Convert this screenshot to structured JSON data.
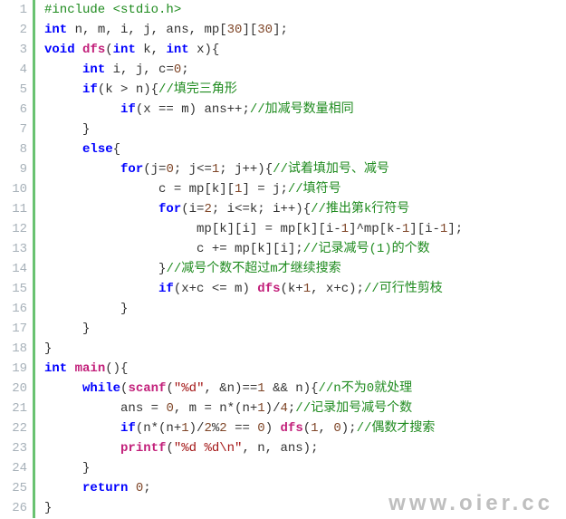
{
  "watermark": "www.oier.cc",
  "lines": [
    {
      "n": "1",
      "tokens": [
        {
          "t": "#include ",
          "c": "tok-inc"
        },
        {
          "t": "<stdio.h>",
          "c": "tok-inc"
        }
      ]
    },
    {
      "n": "2",
      "tokens": [
        {
          "t": "int",
          "c": "tok-kw"
        },
        {
          "t": " n, m, i, j, ans, mp[",
          "c": "tok-id"
        },
        {
          "t": "30",
          "c": "tok-num"
        },
        {
          "t": "][",
          "c": "tok-id"
        },
        {
          "t": "30",
          "c": "tok-num"
        },
        {
          "t": "];",
          "c": "tok-id"
        }
      ]
    },
    {
      "n": "3",
      "tokens": [
        {
          "t": "void",
          "c": "tok-kw"
        },
        {
          "t": " ",
          "c": "tok-id"
        },
        {
          "t": "dfs",
          "c": "tok-fn"
        },
        {
          "t": "(",
          "c": "tok-id"
        },
        {
          "t": "int",
          "c": "tok-kw"
        },
        {
          "t": " k, ",
          "c": "tok-id"
        },
        {
          "t": "int",
          "c": "tok-kw"
        },
        {
          "t": " x){",
          "c": "tok-id"
        }
      ]
    },
    {
      "n": "4",
      "indent": 1,
      "tokens": [
        {
          "t": "int",
          "c": "tok-kw"
        },
        {
          "t": " i, j, c=",
          "c": "tok-id"
        },
        {
          "t": "0",
          "c": "tok-num"
        },
        {
          "t": ";",
          "c": "tok-id"
        }
      ]
    },
    {
      "n": "5",
      "indent": 1,
      "tokens": [
        {
          "t": "if",
          "c": "tok-kw"
        },
        {
          "t": "(k > n){",
          "c": "tok-id"
        },
        {
          "t": "//填完三角形",
          "c": "tok-cmt"
        }
      ]
    },
    {
      "n": "6",
      "indent": 2,
      "tokens": [
        {
          "t": "if",
          "c": "tok-kw"
        },
        {
          "t": "(x == m) ans++;",
          "c": "tok-id"
        },
        {
          "t": "//加减号数量相同",
          "c": "tok-cmt"
        }
      ]
    },
    {
      "n": "7",
      "indent": 1,
      "tokens": [
        {
          "t": "}",
          "c": "tok-id"
        }
      ]
    },
    {
      "n": "8",
      "indent": 1,
      "tokens": [
        {
          "t": "else",
          "c": "tok-kw"
        },
        {
          "t": "{",
          "c": "tok-id"
        }
      ]
    },
    {
      "n": "9",
      "indent": 2,
      "tokens": [
        {
          "t": "for",
          "c": "tok-kw"
        },
        {
          "t": "(j=",
          "c": "tok-id"
        },
        {
          "t": "0",
          "c": "tok-num"
        },
        {
          "t": "; j<=",
          "c": "tok-id"
        },
        {
          "t": "1",
          "c": "tok-num"
        },
        {
          "t": "; j++){",
          "c": "tok-id"
        },
        {
          "t": "//试着填加号、减号",
          "c": "tok-cmt"
        }
      ]
    },
    {
      "n": "10",
      "indent": 3,
      "tokens": [
        {
          "t": "c = mp[k][",
          "c": "tok-id"
        },
        {
          "t": "1",
          "c": "tok-num"
        },
        {
          "t": "] = j;",
          "c": "tok-id"
        },
        {
          "t": "//填符号",
          "c": "tok-cmt"
        }
      ]
    },
    {
      "n": "11",
      "indent": 3,
      "tokens": [
        {
          "t": "for",
          "c": "tok-kw"
        },
        {
          "t": "(i=",
          "c": "tok-id"
        },
        {
          "t": "2",
          "c": "tok-num"
        },
        {
          "t": "; i<=k; i++){",
          "c": "tok-id"
        },
        {
          "t": "//推出第k行符号",
          "c": "tok-cmt"
        }
      ]
    },
    {
      "n": "12",
      "indent": 4,
      "tokens": [
        {
          "t": "mp[k][i] = mp[k][i-",
          "c": "tok-id"
        },
        {
          "t": "1",
          "c": "tok-num"
        },
        {
          "t": "]^mp[k-",
          "c": "tok-id"
        },
        {
          "t": "1",
          "c": "tok-num"
        },
        {
          "t": "][i-",
          "c": "tok-id"
        },
        {
          "t": "1",
          "c": "tok-num"
        },
        {
          "t": "];",
          "c": "tok-id"
        }
      ]
    },
    {
      "n": "13",
      "indent": 4,
      "tokens": [
        {
          "t": "c += mp[k][i];",
          "c": "tok-id"
        },
        {
          "t": "//记录减号(1)的个数",
          "c": "tok-cmt"
        }
      ]
    },
    {
      "n": "14",
      "indent": 3,
      "tokens": [
        {
          "t": "}",
          "c": "tok-id"
        },
        {
          "t": "//减号个数不超过m才继续搜索",
          "c": "tok-cmt"
        }
      ]
    },
    {
      "n": "15",
      "indent": 3,
      "tokens": [
        {
          "t": "if",
          "c": "tok-kw"
        },
        {
          "t": "(x+c <= m) ",
          "c": "tok-id"
        },
        {
          "t": "dfs",
          "c": "tok-fn"
        },
        {
          "t": "(k+",
          "c": "tok-id"
        },
        {
          "t": "1",
          "c": "tok-num"
        },
        {
          "t": ", x+c);",
          "c": "tok-id"
        },
        {
          "t": "//可行性剪枝",
          "c": "tok-cmt"
        }
      ]
    },
    {
      "n": "16",
      "indent": 2,
      "tokens": [
        {
          "t": "}",
          "c": "tok-id"
        }
      ]
    },
    {
      "n": "17",
      "indent": 1,
      "tokens": [
        {
          "t": "}",
          "c": "tok-id"
        }
      ]
    },
    {
      "n": "18",
      "tokens": [
        {
          "t": "}",
          "c": "tok-id"
        }
      ]
    },
    {
      "n": "19",
      "tokens": [
        {
          "t": "int",
          "c": "tok-kw"
        },
        {
          "t": " ",
          "c": "tok-id"
        },
        {
          "t": "main",
          "c": "tok-fn"
        },
        {
          "t": "(){",
          "c": "tok-id"
        }
      ]
    },
    {
      "n": "20",
      "indent": 1,
      "tokens": [
        {
          "t": "while",
          "c": "tok-kw"
        },
        {
          "t": "(",
          "c": "tok-id"
        },
        {
          "t": "scanf",
          "c": "tok-fn"
        },
        {
          "t": "(",
          "c": "tok-id"
        },
        {
          "t": "\"%d\"",
          "c": "tok-str"
        },
        {
          "t": ", &n)==",
          "c": "tok-id"
        },
        {
          "t": "1",
          "c": "tok-num"
        },
        {
          "t": " && n){",
          "c": "tok-id"
        },
        {
          "t": "//n不为0就处理",
          "c": "tok-cmt"
        }
      ]
    },
    {
      "n": "21",
      "indent": 2,
      "tokens": [
        {
          "t": "ans = ",
          "c": "tok-id"
        },
        {
          "t": "0",
          "c": "tok-num"
        },
        {
          "t": ", m = n*(n+",
          "c": "tok-id"
        },
        {
          "t": "1",
          "c": "tok-num"
        },
        {
          "t": ")/",
          "c": "tok-id"
        },
        {
          "t": "4",
          "c": "tok-num"
        },
        {
          "t": ";",
          "c": "tok-id"
        },
        {
          "t": "//记录加号减号个数",
          "c": "tok-cmt"
        }
      ]
    },
    {
      "n": "22",
      "indent": 2,
      "tokens": [
        {
          "t": "if",
          "c": "tok-kw"
        },
        {
          "t": "(n*(n+",
          "c": "tok-id"
        },
        {
          "t": "1",
          "c": "tok-num"
        },
        {
          "t": ")/",
          "c": "tok-id"
        },
        {
          "t": "2",
          "c": "tok-num"
        },
        {
          "t": "%",
          "c": "tok-id"
        },
        {
          "t": "2",
          "c": "tok-num"
        },
        {
          "t": " == ",
          "c": "tok-id"
        },
        {
          "t": "0",
          "c": "tok-num"
        },
        {
          "t": ") ",
          "c": "tok-id"
        },
        {
          "t": "dfs",
          "c": "tok-fn"
        },
        {
          "t": "(",
          "c": "tok-id"
        },
        {
          "t": "1",
          "c": "tok-num"
        },
        {
          "t": ", ",
          "c": "tok-id"
        },
        {
          "t": "0",
          "c": "tok-num"
        },
        {
          "t": ");",
          "c": "tok-id"
        },
        {
          "t": "//偶数才搜索",
          "c": "tok-cmt"
        }
      ]
    },
    {
      "n": "23",
      "indent": 2,
      "tokens": [
        {
          "t": "printf",
          "c": "tok-fn"
        },
        {
          "t": "(",
          "c": "tok-id"
        },
        {
          "t": "\"%d %d\\n\"",
          "c": "tok-str"
        },
        {
          "t": ", n, ans);",
          "c": "tok-id"
        }
      ]
    },
    {
      "n": "24",
      "indent": 1,
      "tokens": [
        {
          "t": "}",
          "c": "tok-id"
        }
      ]
    },
    {
      "n": "25",
      "indent": 1,
      "tokens": [
        {
          "t": "return",
          "c": "tok-kw"
        },
        {
          "t": " ",
          "c": "tok-id"
        },
        {
          "t": "0",
          "c": "tok-num"
        },
        {
          "t": ";",
          "c": "tok-id"
        }
      ]
    },
    {
      "n": "26",
      "tokens": [
        {
          "t": "}",
          "c": "tok-id"
        }
      ]
    }
  ],
  "indent_unit": "     "
}
